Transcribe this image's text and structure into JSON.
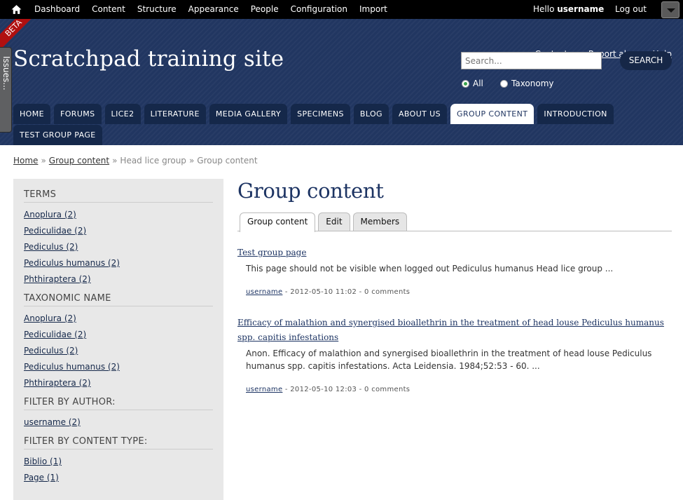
{
  "toolbar": {
    "menu": [
      "Dashboard",
      "Content",
      "Structure",
      "Appearance",
      "People",
      "Configuration",
      "Import"
    ],
    "hello_prefix": "Hello ",
    "username": "username",
    "logout": "Log out"
  },
  "beta_label": "BETA",
  "issues_label": "Issues...",
  "header": {
    "links": [
      "Contact us",
      "Report abuse",
      "Help"
    ],
    "site_name": "Scratchpad training site",
    "search_placeholder": "Search...",
    "search_button": "SEARCH",
    "radio_all": "All",
    "radio_taxonomy": "Taxonomy"
  },
  "nav": {
    "row1": [
      "HOME",
      "FORUMS",
      "LICE2",
      "LITERATURE",
      "MEDIA GALLERY",
      "SPECIMENS",
      "BLOG",
      "ABOUT US",
      "GROUP CONTENT",
      "INTRODUCTION"
    ],
    "row2": [
      "TEST GROUP PAGE"
    ],
    "active": "GROUP CONTENT"
  },
  "breadcrumb": {
    "home": "Home",
    "group_content": "Group content",
    "head_lice": "Head lice group",
    "current": "Group content",
    "separator": "»"
  },
  "sidebar": {
    "facets": [
      {
        "title": "TERMS",
        "items": [
          "Anoplura (2)",
          "Pediculidae (2)",
          "Pediculus (2)",
          "Pediculus humanus (2)",
          "Phthiraptera (2)"
        ]
      },
      {
        "title": "TAXONOMIC NAME",
        "items": [
          "Anoplura (2)",
          "Pediculidae (2)",
          "Pediculus (2)",
          "Pediculus humanus (2)",
          "Phthiraptera (2)"
        ]
      },
      {
        "title": "FILTER BY AUTHOR:",
        "items": [
          "username (2)"
        ]
      },
      {
        "title": "FILTER BY CONTENT TYPE:",
        "items": [
          "Biblio (1)",
          "Page (1)"
        ]
      }
    ]
  },
  "main": {
    "title": "Group content",
    "tabs": [
      "Group content",
      "Edit",
      "Members"
    ],
    "nodes": [
      {
        "title": "Test group page",
        "teaser": "This page should not be visible when logged out Pediculus humanus Head lice group ...",
        "author": "username",
        "meta": " - 2012-05-10 11:02 - 0 comments"
      },
      {
        "title": "Efficacy of malathion and synergised bioallethrin in the treatment of head louse Pediculus humanus spp. capitis infestations",
        "teaser": "Anon. Efficacy of malathion and synergised bioallethrin in the treatment of head louse Pediculus humanus spp. capitis infestations. Acta Leidensia. 1984;52:53 - 60. ...",
        "author": "username",
        "meta": " - 2012-05-10 12:03 - 0 comments"
      }
    ]
  }
}
